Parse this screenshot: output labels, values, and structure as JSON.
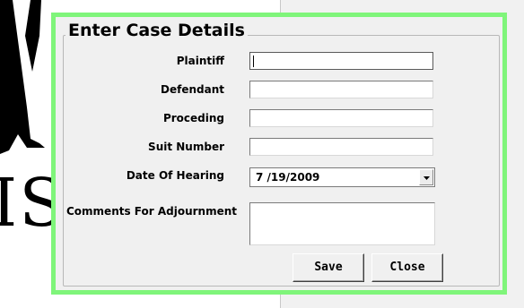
{
  "background": {
    "partial_letters": "IST"
  },
  "dialog": {
    "title": "Enter Case Details",
    "fields": {
      "plaintiff": {
        "label": "Plaintiff",
        "value": ""
      },
      "defendant": {
        "label": "Defendant",
        "value": ""
      },
      "proceding": {
        "label": "Proceding",
        "value": ""
      },
      "suit_number": {
        "label": "Suit Number",
        "value": ""
      },
      "date_of_hearing": {
        "label": "Date Of Hearing",
        "value": "7 /19/2009"
      },
      "comments": {
        "label": "Comments For Adjournment",
        "value": ""
      }
    },
    "buttons": {
      "save": "Save",
      "close": "Close"
    },
    "colors": {
      "frame": "#7ff57a",
      "background": "#f0f0f0"
    },
    "icons": {
      "dropdown": "chevron-down-icon"
    }
  }
}
